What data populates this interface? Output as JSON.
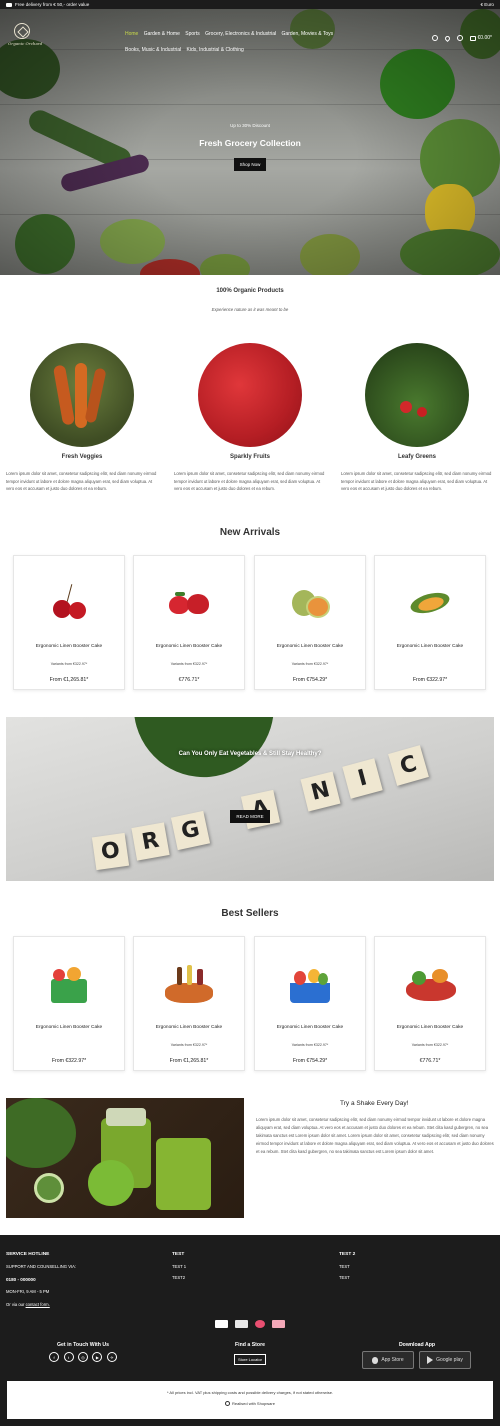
{
  "topbar": {
    "delivery": "Free delivery from € 50,- order value",
    "currency": "€ Euro"
  },
  "logo": {
    "text": "Organic Orchard"
  },
  "nav": {
    "items": [
      "Home",
      "Garden & Home",
      "Sports",
      "Grocery, Electronics & Industrial",
      "Garden, Movies & Toys",
      "Books, Music & Industrial",
      "Kids, Industrial & Clothing"
    ]
  },
  "header": {
    "cart_total": "€0.00*"
  },
  "hero": {
    "eyebrow": "Up to 30% Discount",
    "title": "Fresh Grocery Collection",
    "button": "Shop Now"
  },
  "organic": {
    "title": "100% Organic Products",
    "subtitle": "Experience nature as it was meant to be"
  },
  "categories": [
    {
      "name": "Fresh Veggies",
      "text": "Lorem ipsum dolor sit amet, consetetur sadipscing elitr, sed diam nonumy eirmod tempor invidunt ut labore et dolore magna aliquyam erat, sed diam voluptua. At vero eos et accusam et justo duo dolores et ea rebum."
    },
    {
      "name": "Sparkly Fruits",
      "text": "Lorem ipsum dolor sit amet, consetetur sadipscing elitr, sed diam nonumy eirmod tempor invidunt ut labore et dolore magna aliquyam erat, sed diam voluptua. At vero eos et accusam et justo duo dolores et ea rebum."
    },
    {
      "name": "Leafy Greens",
      "text": "Lorem ipsum dolor sit amet, consetetur sadipscing elitr, sed diam nonumy eirmod tempor invidunt ut labore et dolore magna aliquyam erat, sed diam voluptua. At vero eos et accusam et justo duo dolores et ea rebum."
    }
  ],
  "new_arrivals": {
    "title": "New Arrivals",
    "products": [
      {
        "name": "Ergonomic Linen Booster Cake",
        "variant": "Variants from €322.97*",
        "price": "From €1,265.81*"
      },
      {
        "name": "Ergonomic Linen Booster Cake",
        "variant": "Variants from €322.97*",
        "price": "€776.71*"
      },
      {
        "name": "Ergonomic Linen Booster Cake",
        "variant": "Variants from €322.97*",
        "price": "From €754.29*"
      },
      {
        "name": "Ergonomic Linen Booster Cake",
        "variant": "",
        "price": "From €322.97*"
      }
    ]
  },
  "banner": {
    "title": "Can You Only Eat Vegetables & Still Stay Healthy?",
    "button": "READ MORE",
    "tiles": [
      "O",
      "R",
      "G",
      "A",
      "N",
      "I",
      "C"
    ]
  },
  "best_sellers": {
    "title": "Best Sellers",
    "products": [
      {
        "name": "Ergonomic Linen Booster Cake",
        "variant": "",
        "price": "From €322.97*"
      },
      {
        "name": "Ergonomic Linen Booster Cake",
        "variant": "Variants from €322.97*",
        "price": "From €1,265.81*"
      },
      {
        "name": "Ergonomic Linen Booster Cake",
        "variant": "Variants from €322.97*",
        "price": "From €754.29*"
      },
      {
        "name": "Ergonomic Linen Booster Cake",
        "variant": "Variants from €322.97*",
        "price": "€776.71*"
      }
    ]
  },
  "shake": {
    "title": "Try a Shake Every Day!",
    "text": "Lorem ipsum dolor sit amet, consetetur sadipscing elitr, sed diam nonumy eirmod tempor invidunt ut labore et dolore magna aliquyam erat, sed diam voluptua. At vero eos et accusam et justo duo dolores et ea rebum. Stet clita kasd gubergren, no sea takimata sanctus est Lorem ipsum dolor sit amet. Lorem ipsum dolor sit amet, consetetur sadipscing elitr, sed diam nonumy eirmod tempor invidunt ut labore et dolore magna aliquyam erat, sed diam voluptua. At vero eos et accusam et justo duo dolores et ea rebum. Stet clita kasd gubergren, no sea takimata sanctus est Lorem ipsum dolor sit amet."
  },
  "footer": {
    "hotline_title": "SERVICE HOTLINE",
    "hotline_sub": "SUPPORT AND COUNSELLING VIA:",
    "phone": "0180 - 000000",
    "hours": "MON-FRI, 9 AM - 5 PM",
    "contact_prefix": "Or via our",
    "contact_link": "contact form.",
    "test_title": "TEST",
    "test_links": [
      "TEST 1",
      "TEST2"
    ],
    "test2_title": "TEST 2",
    "test2_links": [
      "TEST",
      "TEST"
    ],
    "touch_title": "Get in Touch With Us",
    "social": [
      "f",
      "t",
      "◎",
      "▶",
      "✈"
    ],
    "store_title": "Find a Store",
    "store_button": "Store Locator",
    "app_title": "Download App",
    "appstore": "App Store",
    "googleplay": "Google play",
    "vat_note": "* All prices incl. VAT plus shipping costs and possible delivery charges, if not stated otherwise.",
    "realised": "Realised with Shopware"
  }
}
